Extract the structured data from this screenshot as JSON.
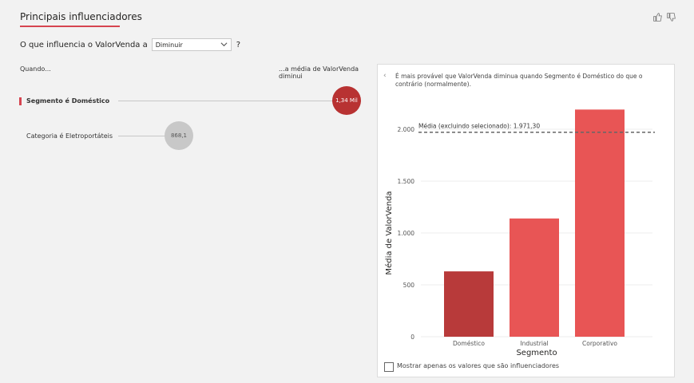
{
  "header": {
    "tab_label": "Principais influenciadores",
    "thumbs_up_icon": "thumbs-up-icon",
    "thumbs_down_icon": "thumbs-down-icon"
  },
  "question": {
    "prefix": "O que influencia o ValorVenda a",
    "selected": "Diminuir",
    "suffix": "?"
  },
  "influencers": {
    "col_when": "Quando...",
    "col_avg": "...a média de ValorVenda diminui",
    "items": [
      {
        "label": "Segmento é Doméstico",
        "value": "1,34 Mil",
        "selected": true
      },
      {
        "label": "Categoria é Eletroportáteis",
        "value": "868,1",
        "selected": false
      }
    ]
  },
  "panel": {
    "description": "É mais provável que ValorVenda diminua quando Segmento é Doméstico do que o contrário (normalmente).",
    "checkbox_label": "Mostrar apenas os valores que são influenciadores"
  },
  "chart_data": {
    "type": "bar",
    "categories": [
      "Doméstico",
      "Industrial",
      "Corporativo"
    ],
    "values": [
      630,
      1140,
      2190
    ],
    "colors": [
      "#b83a3a",
      "#e85555",
      "#e85555"
    ],
    "xlabel": "Segmento",
    "ylabel": "Média de ValorVenda",
    "ylim": [
      0,
      2000
    ],
    "yticks": [
      0,
      500,
      1000,
      1500,
      2000
    ],
    "ytick_labels": [
      "0",
      "500",
      "1.000",
      "1.500",
      "2.000"
    ],
    "reference_line": {
      "value": 1971.3,
      "label": "Média (excluindo selecionado): 1.971,30"
    }
  }
}
